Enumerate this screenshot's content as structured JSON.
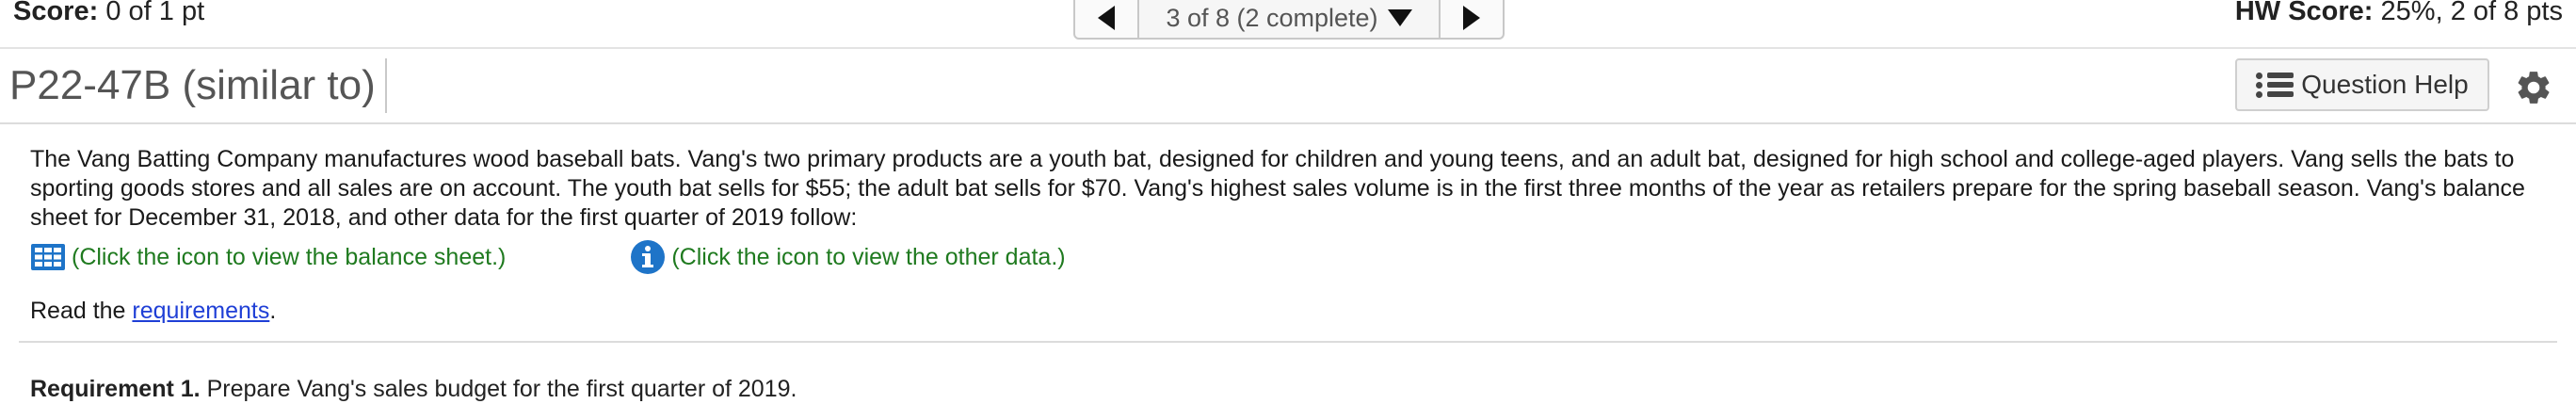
{
  "header": {
    "score_label": "Score:",
    "score_value": "0 of 1 pt",
    "nav_position": "3 of 8 (2 complete)",
    "hw_label": "HW Score:",
    "hw_value": "25%, 2 of 8 pts"
  },
  "question": {
    "title": "P22-47B (similar to)",
    "help_label": "Question Help"
  },
  "content": {
    "paragraph": "The Vang Batting Company manufactures wood baseball bats. Vang's two primary products are a youth bat, designed for children and young teens, and an adult bat, designed for high school and college-aged players. Vang sells the bats to sporting goods stores and all sales are on account. The youth bat sells for $55; the adult bat sells for $70. Vang's highest sales volume is in the first three months of the year as retailers prepare for the spring baseball season. Vang's balance sheet for December 31, 2018, and other data for the first quarter of 2019 follow:",
    "balance_link": "(Click the icon to view the balance sheet.)",
    "other_link": "(Click the icon to view the other data.)",
    "read_prefix": "Read the",
    "requirements_link": "requirements",
    "read_suffix": ".",
    "req_label": "Requirement 1.",
    "req_text": "Prepare Vang's sales budget for the first quarter of 2019."
  },
  "colors": {
    "link_green": "#1f7a1f",
    "link_blue": "#1f3fd6",
    "icon_blue": "#1e74c8"
  },
  "icons": [
    "nav-prev-icon",
    "dropdown-icon",
    "nav-next-icon",
    "list-icon",
    "gear-icon",
    "table-icon",
    "info-icon"
  ]
}
